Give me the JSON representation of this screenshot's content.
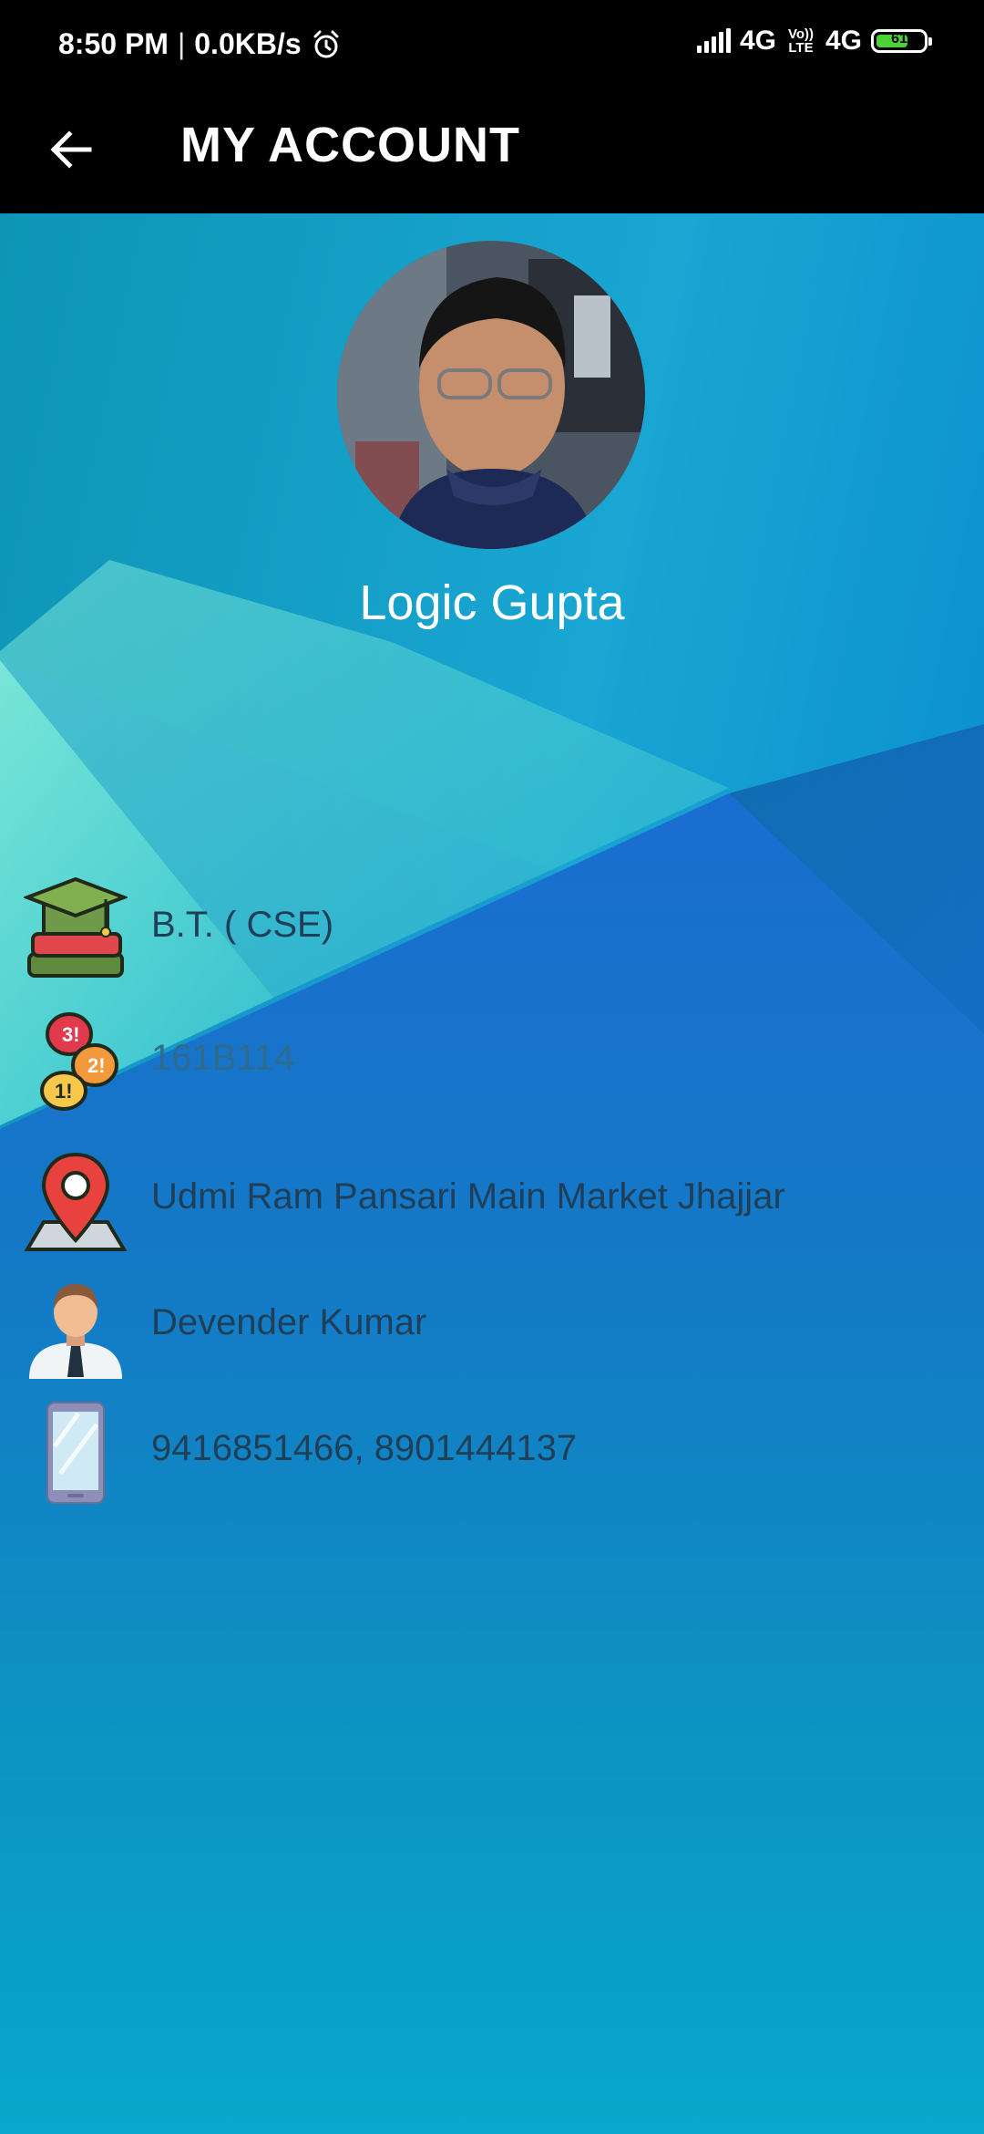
{
  "status_bar": {
    "time": "8:50 PM",
    "separator": "|",
    "speed": "0.0KB/s",
    "alarm_icon": "alarm-icon",
    "network1": "4G",
    "volte": "Vo)) LTE",
    "network2": "4G",
    "battery": "61"
  },
  "app_bar": {
    "back_icon": "arrow-left-icon",
    "title": "MY ACCOUNT"
  },
  "profile": {
    "name": "Logic Gupta"
  },
  "details": [
    {
      "icon": "graduation-cap-icon",
      "text": "B.T. ( CSE)"
    },
    {
      "icon": "chat-bubbles-icon",
      "text": "161B114"
    },
    {
      "icon": "location-pin-icon",
      "text": "Udmi Ram Pansari Main Market Jhajjar"
    },
    {
      "icon": "person-icon",
      "text": "Devender Kumar"
    },
    {
      "icon": "mobile-phone-icon",
      "text": "9416851466, 8901444137"
    }
  ],
  "colors": {
    "app_bar": "#000000",
    "background": "#0b8fc8",
    "detail_text": "#1e3f57"
  }
}
